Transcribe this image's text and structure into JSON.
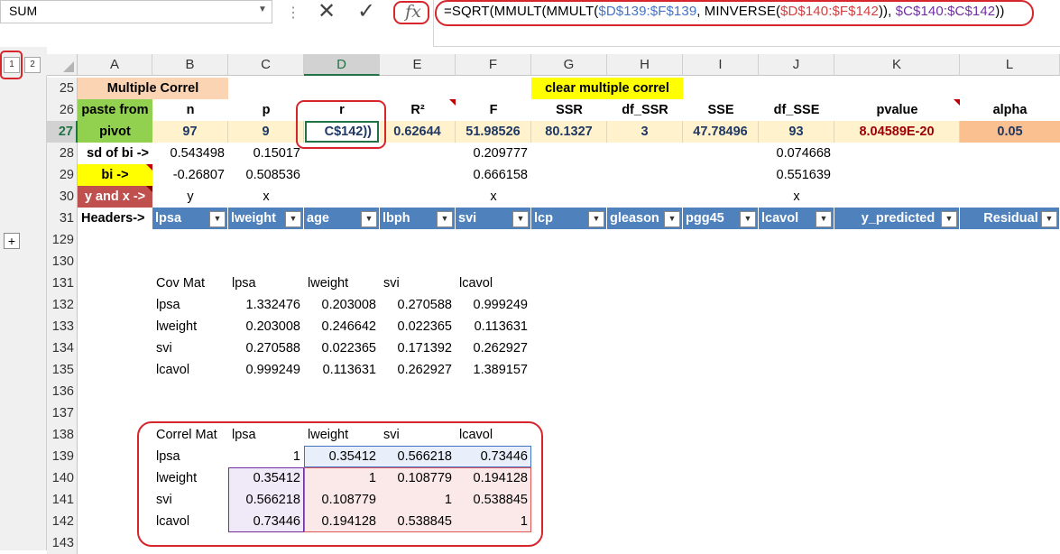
{
  "formula_bar": {
    "name_box": "SUM",
    "formula_parts": [
      "=SQRT(MMULT(MMULT(",
      "$D$139:$F$139",
      ", MINVERSE(",
      "$D$140:$F$142",
      ")), ",
      "$C$140:$C$142",
      "))"
    ]
  },
  "outline": {
    "levels": [
      "1",
      "2"
    ],
    "expand": "+"
  },
  "columns": [
    "A",
    "B",
    "C",
    "D",
    "E",
    "F",
    "G",
    "H",
    "I",
    "J",
    "K",
    "L"
  ],
  "selected_column": "D",
  "rows": [
    "25",
    "26",
    "27",
    "28",
    "29",
    "30",
    "31",
    "129",
    "130",
    "131",
    "132",
    "133",
    "134",
    "135",
    "136",
    "137",
    "138",
    "139",
    "140",
    "141",
    "142",
    "143"
  ],
  "selected_row": "27",
  "sheet": {
    "a25": "Multiple Correl",
    "g25": "clear multiple correl",
    "a26": "paste from",
    "a27": "pivot",
    "headers26": {
      "b": "n",
      "c": "p",
      "d": "r",
      "e": "R²",
      "f": "F",
      "g": "SSR",
      "h": "df_SSR",
      "i": "SSE",
      "j": "df_SSE",
      "k": "pvalue",
      "l": "alpha"
    },
    "values27": {
      "b": "97",
      "c": "9",
      "d": "C$142))",
      "e": "0.62644",
      "f": "51.98526",
      "g": "80.1327",
      "h": "3",
      "i": "47.78496",
      "j": "93",
      "k": "8.04589E-20",
      "l": "0.05"
    },
    "a28": "sd of bi ->",
    "row28": {
      "b": "0.543498",
      "c": "0.15017",
      "f": "0.209777",
      "j": "0.074668"
    },
    "a29": "bi ->",
    "row29": {
      "b": "-0.26807",
      "c": "0.508536",
      "f": "0.666158",
      "j": "0.551639"
    },
    "a30": "y and x ->",
    "row30": {
      "b": "y",
      "c": "x",
      "f": "x",
      "j": "x"
    },
    "a31": "Headers->",
    "table_headers": [
      "lpsa",
      "lweight",
      "age",
      "lbph",
      "svi",
      "lcp",
      "gleason",
      "pgg45",
      "lcavol",
      "y_predicted",
      "Residual"
    ]
  },
  "cov_mat": {
    "title": "Cov Mat",
    "cols": [
      "lpsa",
      "lweight",
      "svi",
      "lcavol"
    ],
    "rows": [
      {
        "name": "lpsa",
        "vals": [
          "1.332476",
          "0.203008",
          "0.270588",
          "0.999249"
        ]
      },
      {
        "name": "lweight",
        "vals": [
          "0.203008",
          "0.246642",
          "0.022365",
          "0.113631"
        ]
      },
      {
        "name": "svi",
        "vals": [
          "0.270588",
          "0.022365",
          "0.171392",
          "0.262927"
        ]
      },
      {
        "name": "lcavol",
        "vals": [
          "0.999249",
          "0.113631",
          "0.262927",
          "1.389157"
        ]
      }
    ]
  },
  "correl_mat": {
    "title": "Correl Mat",
    "cols": [
      "lpsa",
      "lweight",
      "svi",
      "lcavol"
    ],
    "rows": [
      {
        "name": "lpsa",
        "vals": [
          "1",
          "0.35412",
          "0.566218",
          "0.73446"
        ]
      },
      {
        "name": "lweight",
        "vals": [
          "0.35412",
          "1",
          "0.108779",
          "0.194128"
        ]
      },
      {
        "name": "svi",
        "vals": [
          "0.566218",
          "0.108779",
          "1",
          "0.538845"
        ]
      },
      {
        "name": "lcavol",
        "vals": [
          "0.73446",
          "0.194128",
          "0.538845",
          "1"
        ]
      }
    ]
  },
  "colors": {
    "peach": "#fbd4b4",
    "yellow": "#ffff00",
    "green": "#92d050",
    "red_label": "#c0504d",
    "orange": "#fac090",
    "table_blue": "#4f81bd",
    "annotation_red": "#d7262b",
    "pvalue_text": "#9c0006"
  }
}
